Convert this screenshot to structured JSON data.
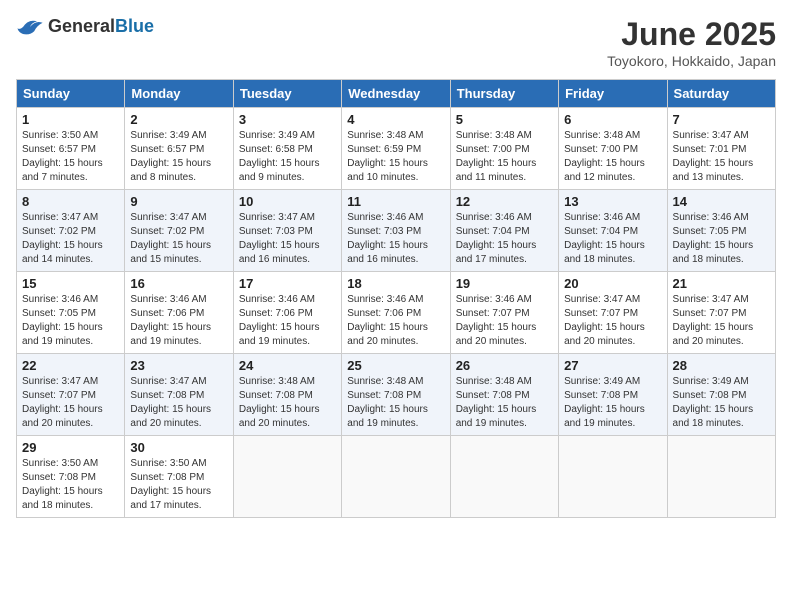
{
  "header": {
    "logo_general": "General",
    "logo_blue": "Blue",
    "month_title": "June 2025",
    "subtitle": "Toyokoro, Hokkaido, Japan"
  },
  "calendar": {
    "days_of_week": [
      "Sunday",
      "Monday",
      "Tuesday",
      "Wednesday",
      "Thursday",
      "Friday",
      "Saturday"
    ],
    "weeks": [
      [
        null,
        {
          "num": "1",
          "sunrise": "3:50 AM",
          "sunset": "6:57 PM",
          "daylight": "15 hours and 7 minutes."
        },
        {
          "num": "2",
          "sunrise": "3:49 AM",
          "sunset": "6:57 PM",
          "daylight": "15 hours and 8 minutes."
        },
        {
          "num": "3",
          "sunrise": "3:49 AM",
          "sunset": "6:58 PM",
          "daylight": "15 hours and 9 minutes."
        },
        {
          "num": "4",
          "sunrise": "3:48 AM",
          "sunset": "6:59 PM",
          "daylight": "15 hours and 10 minutes."
        },
        {
          "num": "5",
          "sunrise": "3:48 AM",
          "sunset": "7:00 PM",
          "daylight": "15 hours and 11 minutes."
        },
        {
          "num": "6",
          "sunrise": "3:48 AM",
          "sunset": "7:00 PM",
          "daylight": "15 hours and 12 minutes."
        },
        {
          "num": "7",
          "sunrise": "3:47 AM",
          "sunset": "7:01 PM",
          "daylight": "15 hours and 13 minutes."
        }
      ],
      [
        {
          "num": "8",
          "sunrise": "3:47 AM",
          "sunset": "7:02 PM",
          "daylight": "15 hours and 14 minutes."
        },
        {
          "num": "9",
          "sunrise": "3:47 AM",
          "sunset": "7:02 PM",
          "daylight": "15 hours and 15 minutes."
        },
        {
          "num": "10",
          "sunrise": "3:47 AM",
          "sunset": "7:03 PM",
          "daylight": "15 hours and 16 minutes."
        },
        {
          "num": "11",
          "sunrise": "3:46 AM",
          "sunset": "7:03 PM",
          "daylight": "15 hours and 16 minutes."
        },
        {
          "num": "12",
          "sunrise": "3:46 AM",
          "sunset": "7:04 PM",
          "daylight": "15 hours and 17 minutes."
        },
        {
          "num": "13",
          "sunrise": "3:46 AM",
          "sunset": "7:04 PM",
          "daylight": "15 hours and 18 minutes."
        },
        {
          "num": "14",
          "sunrise": "3:46 AM",
          "sunset": "7:05 PM",
          "daylight": "15 hours and 18 minutes."
        }
      ],
      [
        {
          "num": "15",
          "sunrise": "3:46 AM",
          "sunset": "7:05 PM",
          "daylight": "15 hours and 19 minutes."
        },
        {
          "num": "16",
          "sunrise": "3:46 AM",
          "sunset": "7:06 PM",
          "daylight": "15 hours and 19 minutes."
        },
        {
          "num": "17",
          "sunrise": "3:46 AM",
          "sunset": "7:06 PM",
          "daylight": "15 hours and 19 minutes."
        },
        {
          "num": "18",
          "sunrise": "3:46 AM",
          "sunset": "7:06 PM",
          "daylight": "15 hours and 20 minutes."
        },
        {
          "num": "19",
          "sunrise": "3:46 AM",
          "sunset": "7:07 PM",
          "daylight": "15 hours and 20 minutes."
        },
        {
          "num": "20",
          "sunrise": "3:47 AM",
          "sunset": "7:07 PM",
          "daylight": "15 hours and 20 minutes."
        },
        {
          "num": "21",
          "sunrise": "3:47 AM",
          "sunset": "7:07 PM",
          "daylight": "15 hours and 20 minutes."
        }
      ],
      [
        {
          "num": "22",
          "sunrise": "3:47 AM",
          "sunset": "7:07 PM",
          "daylight": "15 hours and 20 minutes."
        },
        {
          "num": "23",
          "sunrise": "3:47 AM",
          "sunset": "7:08 PM",
          "daylight": "15 hours and 20 minutes."
        },
        {
          "num": "24",
          "sunrise": "3:48 AM",
          "sunset": "7:08 PM",
          "daylight": "15 hours and 20 minutes."
        },
        {
          "num": "25",
          "sunrise": "3:48 AM",
          "sunset": "7:08 PM",
          "daylight": "15 hours and 19 minutes."
        },
        {
          "num": "26",
          "sunrise": "3:48 AM",
          "sunset": "7:08 PM",
          "daylight": "15 hours and 19 minutes."
        },
        {
          "num": "27",
          "sunrise": "3:49 AM",
          "sunset": "7:08 PM",
          "daylight": "15 hours and 19 minutes."
        },
        {
          "num": "28",
          "sunrise": "3:49 AM",
          "sunset": "7:08 PM",
          "daylight": "15 hours and 18 minutes."
        }
      ],
      [
        {
          "num": "29",
          "sunrise": "3:50 AM",
          "sunset": "7:08 PM",
          "daylight": "15 hours and 18 minutes."
        },
        {
          "num": "30",
          "sunrise": "3:50 AM",
          "sunset": "7:08 PM",
          "daylight": "15 hours and 17 minutes."
        },
        null,
        null,
        null,
        null,
        null
      ]
    ]
  }
}
